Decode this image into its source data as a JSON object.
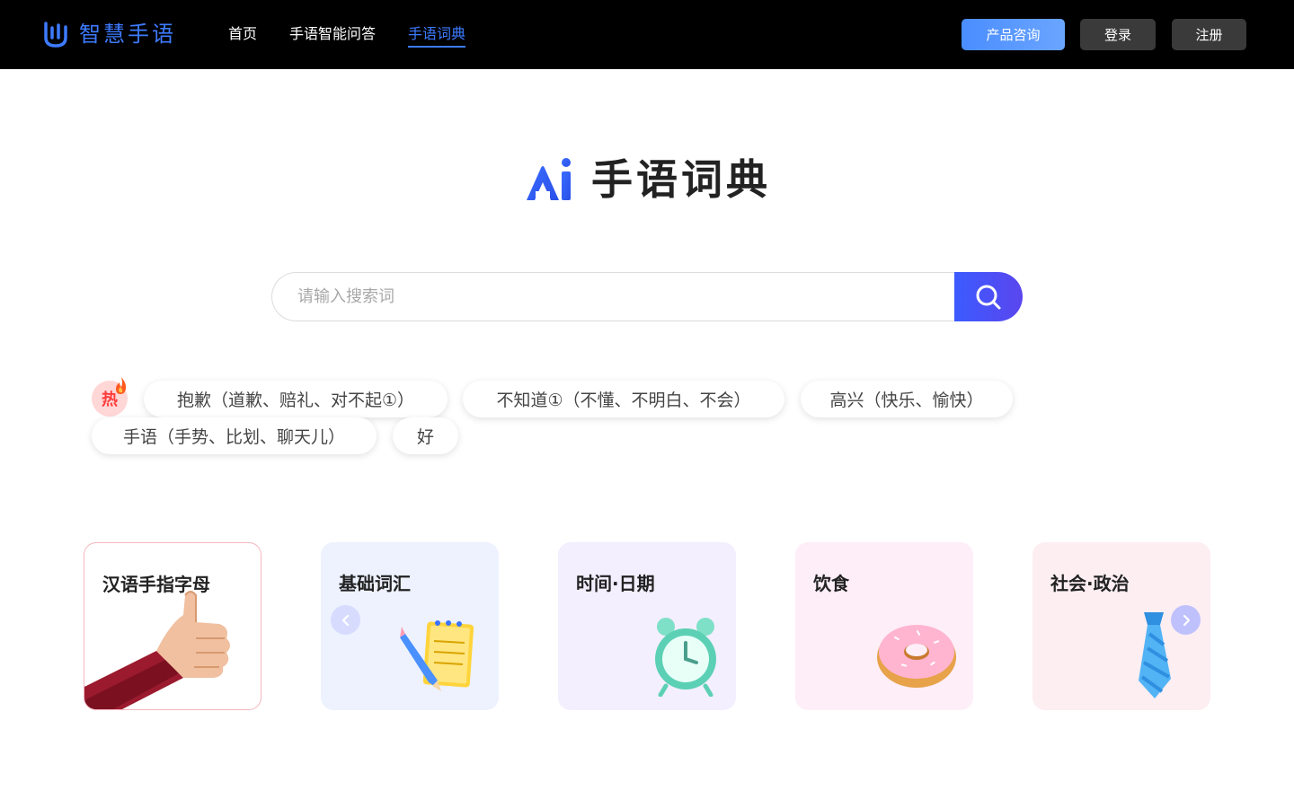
{
  "header": {
    "logo_text": "智慧手语",
    "nav": [
      {
        "label": "首页"
      },
      {
        "label": "手语智能问答"
      },
      {
        "label": "手语词典"
      }
    ],
    "consult_label": "产品咨询",
    "login_label": "登录",
    "register_label": "注册"
  },
  "hero": {
    "title": "手语词典"
  },
  "search": {
    "placeholder": "请输入搜索词",
    "value": ""
  },
  "hot": {
    "badge": "热",
    "tags": [
      "抱歉（道歉、赔礼、对不起①）",
      "不知道①（不懂、不明白、不会）",
      "高兴（快乐、愉快）",
      "手语（手势、比划、聊天儿）",
      "好"
    ]
  },
  "categories": [
    {
      "title": "汉语手指字母",
      "icon": "thumbs-up-hand-icon"
    },
    {
      "title": "基础词汇",
      "icon": "notepad-pencil-icon"
    },
    {
      "title": "时间·日期",
      "icon": "alarm-clock-icon"
    },
    {
      "title": "饮食",
      "icon": "donut-icon"
    },
    {
      "title": "社会·政治",
      "icon": "necktie-icon"
    }
  ],
  "colors": {
    "accent": "#3d7bff",
    "search_button": "#4a50f5",
    "header_bg": "#000000"
  }
}
